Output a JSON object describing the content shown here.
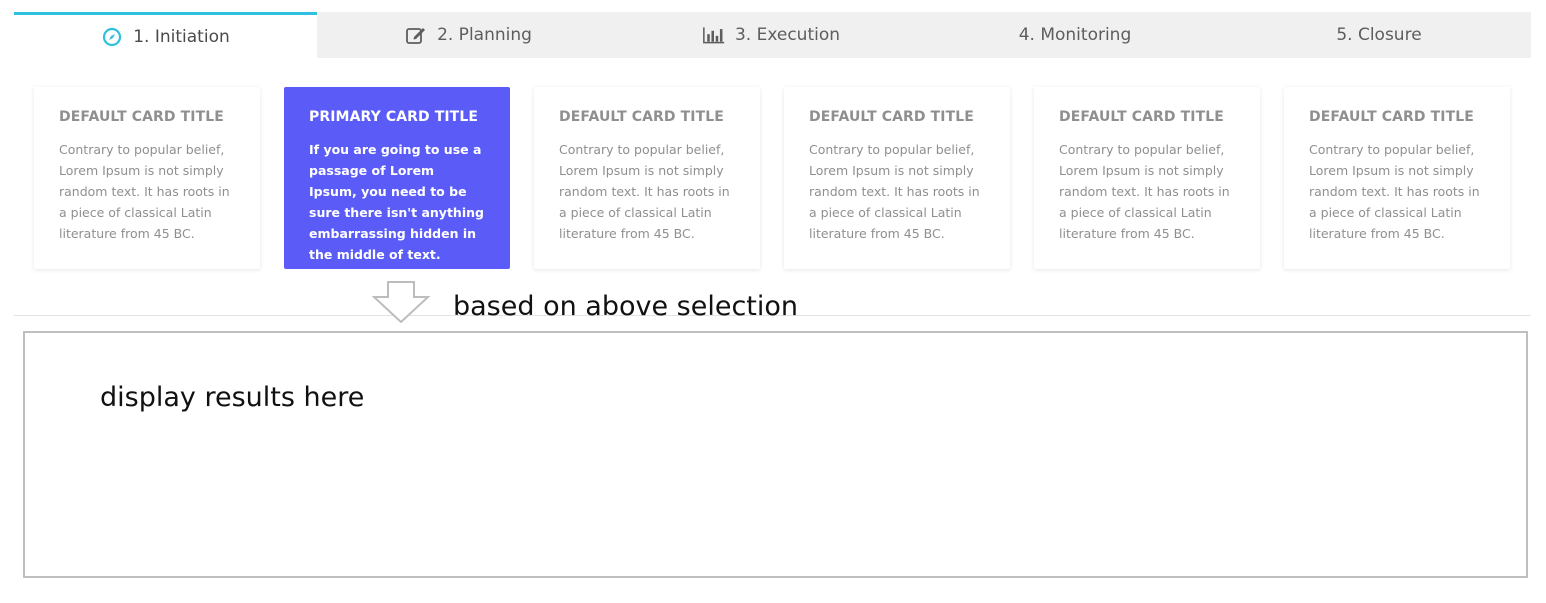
{
  "tabs": [
    {
      "label": "1. Initiation",
      "icon": "compass-icon",
      "active": true
    },
    {
      "label": "2. Planning",
      "icon": "edit-icon",
      "active": false
    },
    {
      "label": "3. Execution",
      "icon": "bar-chart-icon",
      "active": false
    },
    {
      "label": "4. Monitoring",
      "icon": "",
      "active": false
    },
    {
      "label": "5. Closure",
      "icon": "",
      "active": false
    }
  ],
  "colors": {
    "accent": "#2ec1dd",
    "primary": "#5b5cf8",
    "tab_bg": "#f0f0f0",
    "muted_text": "#8f8f8f"
  },
  "cards": [
    {
      "title": "DEFAULT CARD TITLE",
      "text": "Contrary to popular belief, Lorem Ipsum is not simply random text. It has roots in a piece of classical Latin literature from 45 BC.",
      "variant": "default"
    },
    {
      "title": "PRIMARY CARD TITLE",
      "text": "If you are going to use a passage of Lorem Ipsum, you need to be sure there isn't anything embarrassing hidden in the middle of text.",
      "variant": "primary"
    },
    {
      "title": "DEFAULT CARD TITLE",
      "text": "Contrary to popular belief, Lorem Ipsum is not simply random text. It has roots in a piece of classical Latin literature from 45 BC.",
      "variant": "default"
    },
    {
      "title": "DEFAULT CARD TITLE",
      "text": "Contrary to popular belief, Lorem Ipsum is not simply random text. It has roots in a piece of classical Latin literature from 45 BC.",
      "variant": "default"
    },
    {
      "title": "DEFAULT CARD TITLE",
      "text": "Contrary to popular belief, Lorem Ipsum is not simply random text. It has roots in a piece of classical Latin literature from 45 BC.",
      "variant": "default"
    },
    {
      "title": "DEFAULT CARD TITLE",
      "text": "Contrary to popular belief, Lorem Ipsum is not simply random text. It has roots in a piece of classical Latin literature from 45 BC.",
      "variant": "default"
    }
  ],
  "annotation": {
    "arrow_icon": "down-arrow-icon",
    "note": "based on above selection"
  },
  "results": {
    "placeholder": "display results here"
  }
}
